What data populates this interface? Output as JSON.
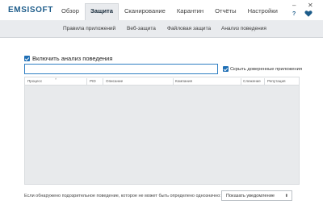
{
  "app": {
    "logo": "EMSISOFT",
    "accent_color": "#1d5c8a",
    "check_color": "#1f6fb5"
  },
  "nav": {
    "tabs": [
      {
        "label": "Обзор"
      },
      {
        "label": "Защита",
        "active": true
      },
      {
        "label": "Сканирование"
      },
      {
        "label": "Карантин"
      },
      {
        "label": "Отчёты"
      },
      {
        "label": "Настройки"
      }
    ]
  },
  "window": {
    "minimize": "–",
    "close": "✕",
    "help": "?"
  },
  "subnav": {
    "items": [
      {
        "label": "Правила приложений"
      },
      {
        "label": "Веб-защита"
      },
      {
        "label": "Файловая защита"
      },
      {
        "label": "Анализ поведения",
        "active": true
      }
    ]
  },
  "behavior": {
    "enable_label": "Включить анализ поведения",
    "enable_checked": true,
    "search_value": "",
    "search_placeholder": "",
    "hide_trusted_label": "Скрыть доверенные приложения",
    "hide_trusted_checked": true
  },
  "table": {
    "columns": [
      "Процесс",
      "PID",
      "Описание",
      "Компания",
      "Слежение",
      "Репутация"
    ],
    "rows": []
  },
  "footer": {
    "text": "Если обнаружено подозрительное поведение, которое не может быть определено однозначно:",
    "select_value": "Показать уведомление",
    "select_arrow": "⬍"
  }
}
